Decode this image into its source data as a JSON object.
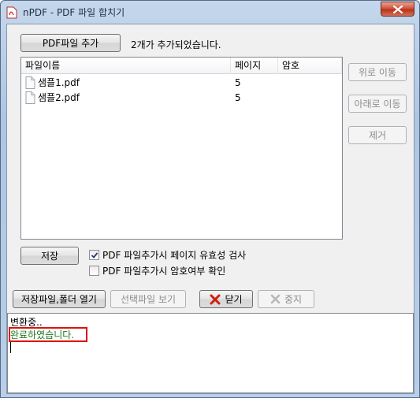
{
  "window": {
    "title": "nPDF - PDF 파일 합치기"
  },
  "toolbar": {
    "add_pdf_label": "PDF파일 추가",
    "status_text": "2개가 추가되었습니다."
  },
  "list": {
    "columns": [
      "파일이름",
      "페이지",
      "암호"
    ],
    "rows": [
      {
        "name": "샘플1.pdf",
        "pages": "5",
        "password": ""
      },
      {
        "name": "샘플2.pdf",
        "pages": "5",
        "password": ""
      }
    ]
  },
  "side": {
    "move_up": "위로 이동",
    "move_down": "아래로 이동",
    "remove": "제거"
  },
  "save": {
    "save_label": "저장",
    "check_validity": {
      "label": "PDF 파일추가시 페이지 유효성 검사",
      "checked": true
    },
    "check_password": {
      "label": "PDF 파일추가시 암호여부 확인",
      "checked": false
    }
  },
  "actions": {
    "open_folder": "저장파일,폴더 열기",
    "view_selected": "선택파일 보기",
    "close": "닫기",
    "stop": "중지"
  },
  "log": {
    "lines": [
      "변환중..",
      "완료하였습니다."
    ],
    "done_color": "#1a7a1a"
  },
  "colors": {
    "accent_red": "#e01010",
    "close_x": "#d02010"
  }
}
